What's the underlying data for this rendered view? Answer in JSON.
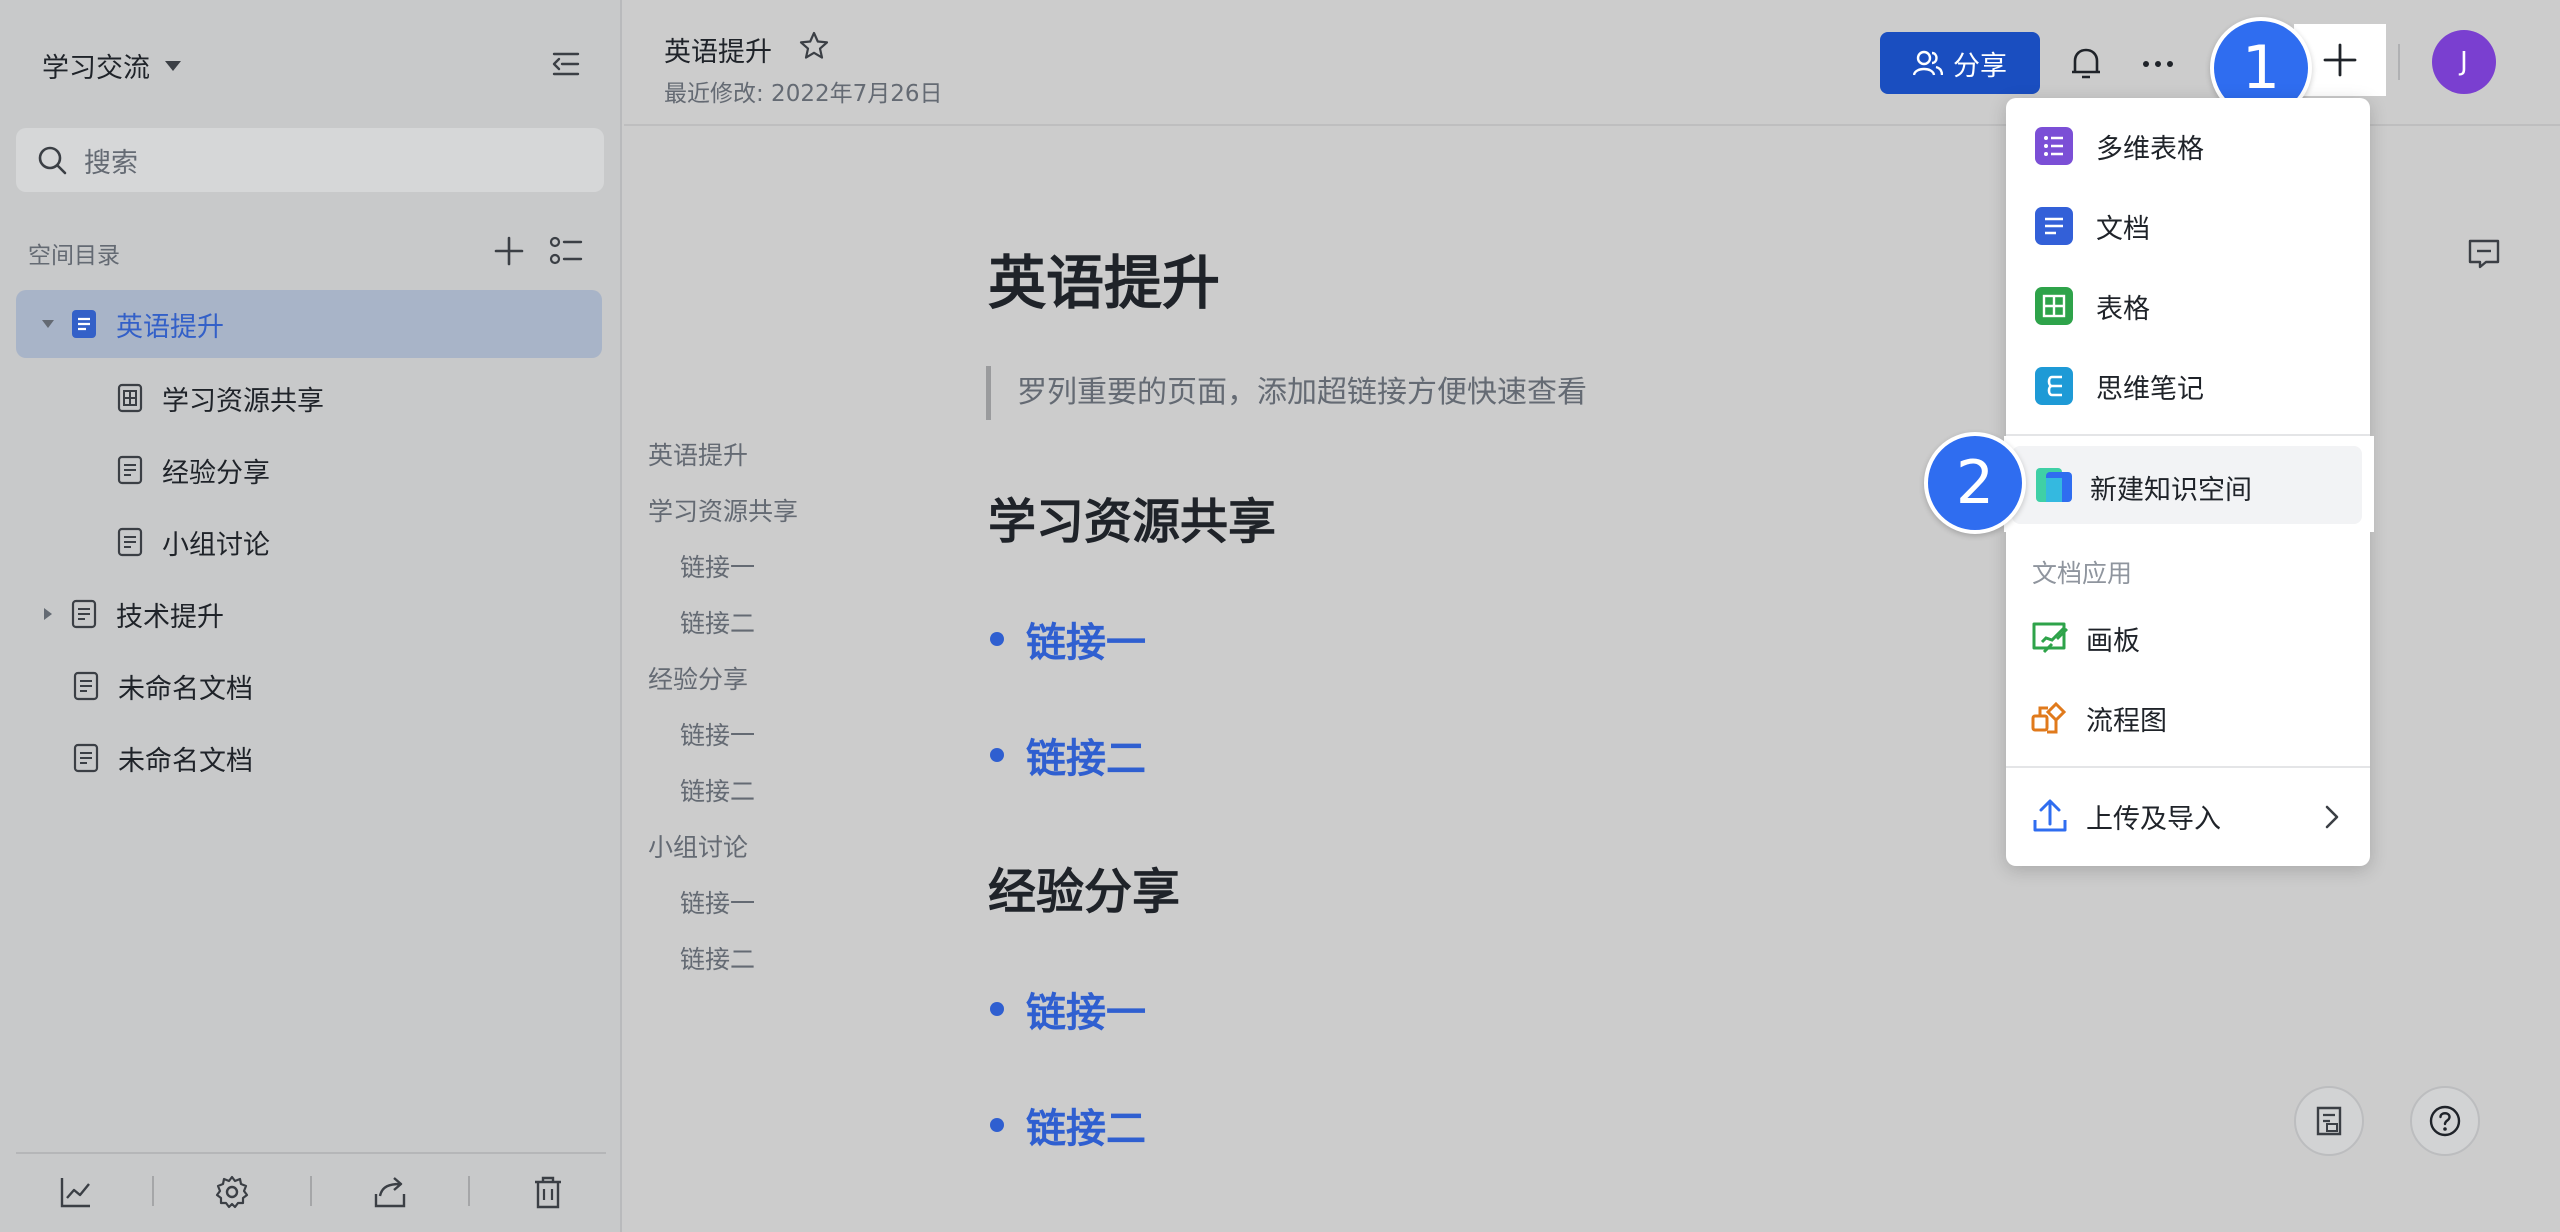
{
  "sidebar": {
    "space_title": "学习交流",
    "search_placeholder": "搜索",
    "dir_header": "空间目录",
    "tree": [
      {
        "label": "英语提升",
        "active": true
      },
      {
        "label": "学习资源共享"
      },
      {
        "label": "经验分享"
      },
      {
        "label": "小组讨论"
      },
      {
        "label": "技术提升"
      },
      {
        "label": "未命名文档"
      },
      {
        "label": "未命名文档"
      }
    ]
  },
  "header": {
    "doc_title": "英语提升",
    "last_modified": "最近修改: 2022年7月26日",
    "share_label": "分享",
    "avatar_letter": "J"
  },
  "outline": [
    "英语提升",
    "学习资源共享",
    "链接一",
    "链接二",
    "经验分享",
    "链接一",
    "链接二",
    "小组讨论",
    "链接一",
    "链接二"
  ],
  "document": {
    "title": "英语提升",
    "quote": "罗列重要的页面，添加超链接方便快速查看",
    "section1": "学习资源共享",
    "s1_link1": "链接一",
    "s1_link2": "链接二",
    "section2": "经验分享",
    "s2_link1": "链接一",
    "s2_link2": "链接二"
  },
  "menu": {
    "items": [
      "多维表格",
      "文档",
      "表格",
      "思维笔记"
    ],
    "new_space": "新建知识空间",
    "section_label": "文档应用",
    "apps": [
      "画板",
      "流程图"
    ],
    "upload": "上传及导入"
  },
  "badges": {
    "step1": "1",
    "step2": "2"
  },
  "colors": {
    "accent": "#2f6df0",
    "share_button": "#1a4ec0",
    "link": "#2f5fd0",
    "avatar": "#7a3fd0"
  }
}
